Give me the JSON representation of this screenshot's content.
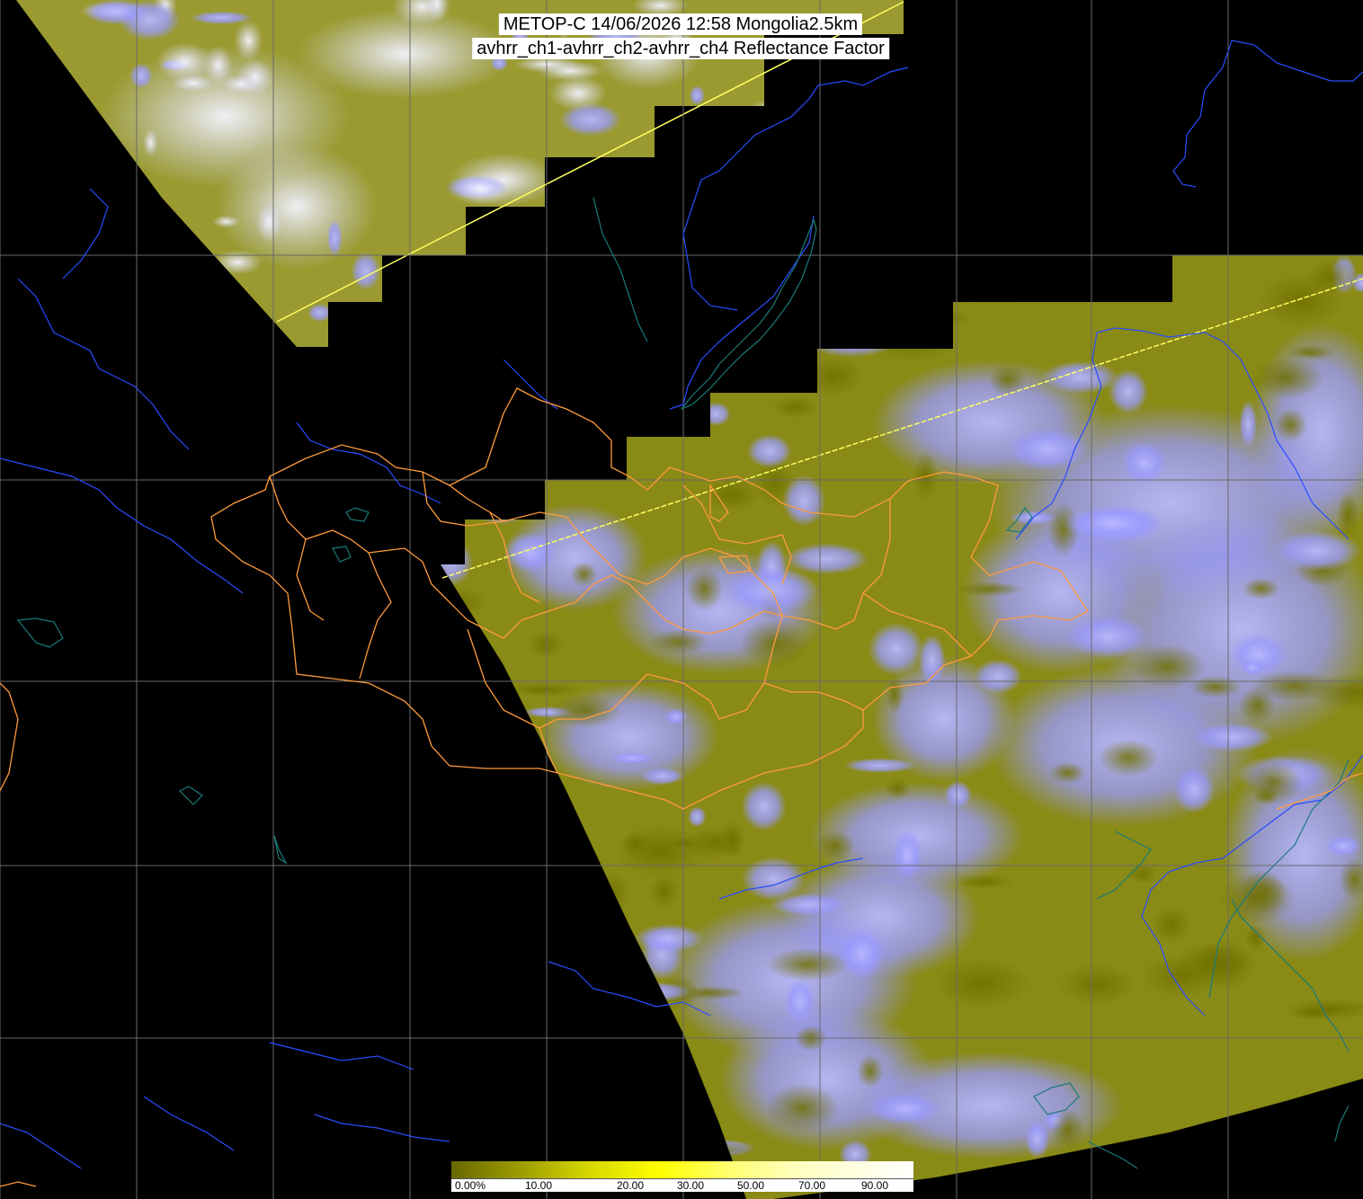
{
  "title": {
    "line1": "METOP-C 14/06/2026 12:58 Mongolia2.5km",
    "line2": "avhrr_ch1-avhrr_ch2-avhrr_ch4 Reflectance Factor"
  },
  "colorbar": {
    "ticks": [
      "0.00%",
      "10.00",
      "20.00",
      "30.00",
      "50.00",
      "70.00",
      "90.00"
    ],
    "colors": [
      "#686800",
      "#9c9c00",
      "#d8d800",
      "#ffff00",
      "#ffff70",
      "#ffffc0",
      "#ffffff"
    ]
  },
  "map": {
    "colors": {
      "background": "#000000",
      "land_clear": "#8a8a16",
      "cloud": "#9a9aff",
      "cloud_bright": "#e8e8ff",
      "graticule": "#6a6a6a",
      "coastline": "#2a4cff",
      "province_border": "#ff9a3c",
      "lakes": "#1a7a7a",
      "swath_edge": "#ffff60"
    }
  }
}
